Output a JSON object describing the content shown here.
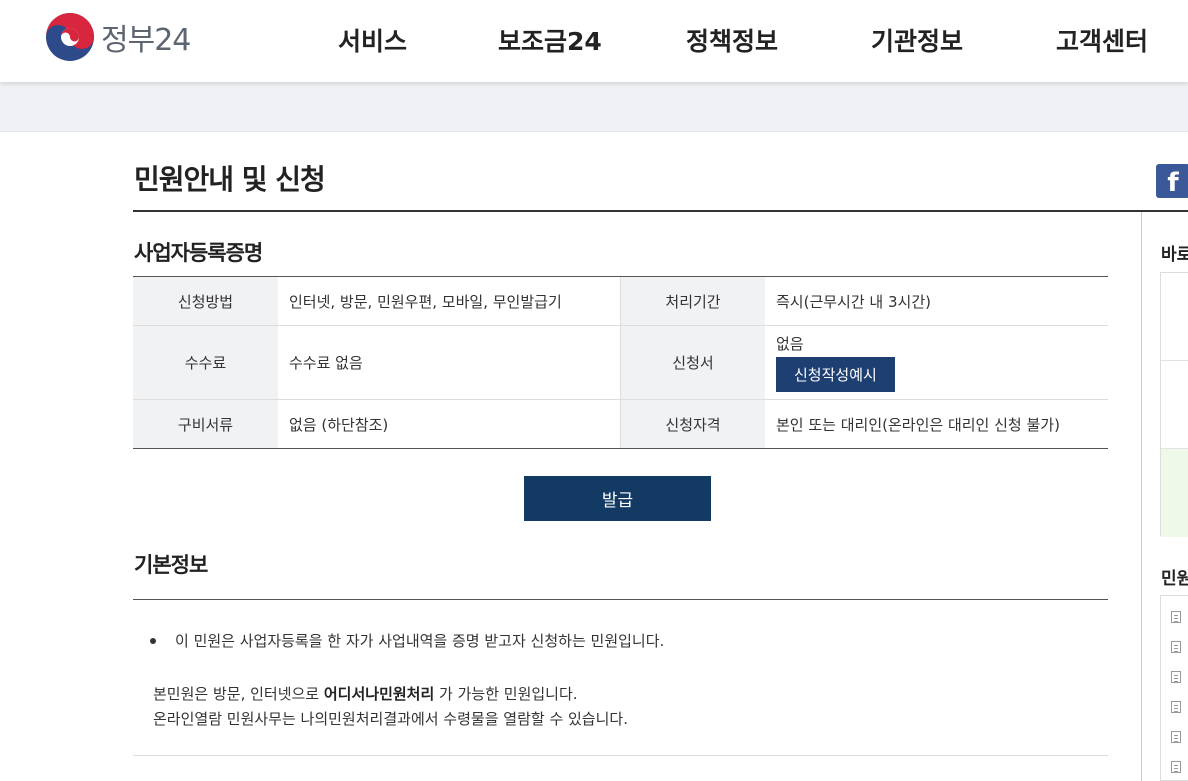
{
  "header": {
    "logo_text": "정부24",
    "nav": [
      "서비스",
      "보조금24",
      "정책정보",
      "기관정보",
      "고객센터"
    ]
  },
  "page": {
    "title": "민원안내 및 신청",
    "social_icon": "facebook-icon"
  },
  "service": {
    "name": "사업자등록증명",
    "table": {
      "method_label": "신청방법",
      "method_value": "인터넷, 방문, 민원우편, 모바일, 무인발급기",
      "period_label": "처리기간",
      "period_value": "즉시(근무시간 내 3시간)",
      "fee_label": "수수료",
      "fee_value": "수수료 없음",
      "form_label": "신청서",
      "form_value": "없음",
      "form_button": "신청작성예시",
      "docs_label": "구비서류",
      "docs_value": "없음 (하단참조)",
      "qual_label": "신청자격",
      "qual_value": "본인 또는 대리인(온라인은 대리인 신청 불가)"
    },
    "issue_button": "발급"
  },
  "basic": {
    "heading": "기본정보",
    "bullet": "이 민원은 사업자등록을 한 자가 사업내역을 증명 받고자 신청하는 민원입니다.",
    "notice_pre": "본민원은 방문, 인터넷으로 ",
    "notice_bold": "어디서나민원처리",
    "notice_post": " 가 가능한 민원입니다.",
    "notice_line2": "온라인열람 민원사무는 나의민원처리결과에서 수령물을 열람할 수 있습니다."
  },
  "sidebar": {
    "heading1": "바로",
    "heading2": "민원"
  },
  "colors": {
    "primary_button": "#123a63",
    "sample_button": "#1d3f72",
    "facebook": "#3b5998"
  }
}
